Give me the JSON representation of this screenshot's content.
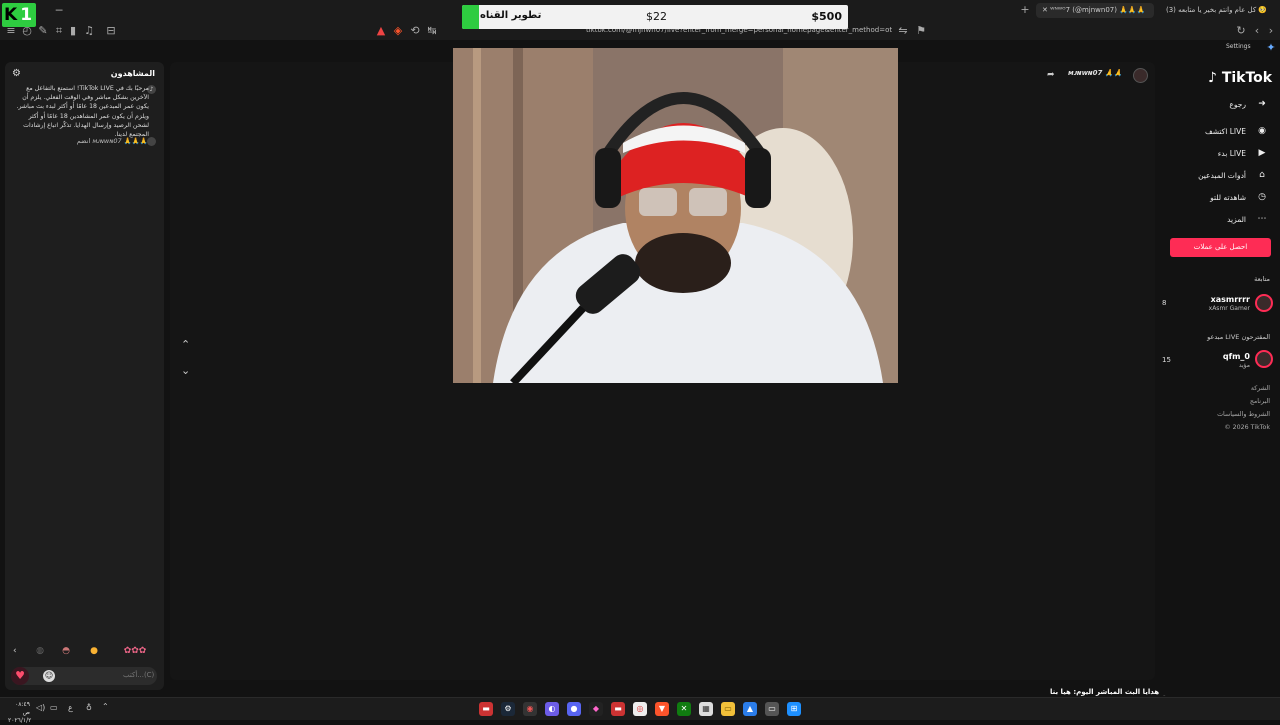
{
  "browser": {
    "logo": "K",
    "logo_num": "1",
    "tabs": [
      {
        "label": "(3) كل عام وانتم بخير يا متابعه 🥺"
      },
      {
        "label": "ᵂᴺᵂᴼ7 (@mjnwn07) 🙏🙏🙏"
      }
    ],
    "url": "tiktok.com/@mjnwn07/live?enter_from_merge=personal_homepage&enter_method=others_photo",
    "settings_label": "Settings"
  },
  "goal": {
    "title": "تطوير القناه",
    "current": "$22",
    "target": "$500",
    "progress_fraction": 0.044
  },
  "chat": {
    "title": "المشاهدون",
    "welcome": "مرحبًا بك في TikTok LIVE! استمتع بالتفاعل مع الآخرين بشكل مباشر وفي الوقت الفعلي. يلزم أن يكون عمر المبدعين 18 عامًا أو أكثر لبدء بث مباشر. ويلزم أن يكون عمر المشاهدين 18 عامًا أو أكثر لشحن الرصيد وإرسال الهدايا. تذكّر اتباع إرشادات المجتمع لدينا.",
    "joined_user": "ᴍᴊɴᴡɴ07",
    "joined_text": "انضم",
    "input_placeholder": "أكتب...(C)",
    "gift_icons": [
      "flower-icon",
      "smile-icon",
      "hat-icon",
      "drop-icon"
    ]
  },
  "stream": {
    "host_name": "ᴍᴊɴᴡɴ07 🙏🙏",
    "bottom_caption": "أفضل هدايا البث المباشر اليوم: هيا بنا"
  },
  "sidebar": {
    "logo": "TikTok",
    "nav": [
      {
        "label": "رجوع",
        "icon": "back-arrow-icon"
      },
      {
        "label": "اكتشف LIVE",
        "icon": "live-icon"
      },
      {
        "label": "بدء LIVE",
        "icon": "camera-icon"
      },
      {
        "label": "أدوات المبدعين",
        "icon": "home-icon"
      },
      {
        "label": "شاهدته للتو",
        "icon": "clock-icon"
      },
      {
        "label": "المزيد",
        "icon": "more-icon"
      }
    ],
    "login_label": "احصل على عملات",
    "section_following": "متابعة",
    "section_suggested": "مبدعو LIVE المقترحون",
    "accounts": [
      {
        "name": "xasmrrrr",
        "sub": "xAsmr Gamer",
        "count": "8"
      },
      {
        "name": "qfm_0",
        "sub": "مؤيد",
        "count": "15"
      }
    ],
    "footer": [
      "الشركة",
      "البرنامج",
      "الشروط والسياسات",
      "© 2026 TikTok"
    ]
  },
  "taskbar": {
    "time": "٠٨:٤٩ ص",
    "date": "٢٠٢٦/١/٢",
    "lang": "ع"
  }
}
